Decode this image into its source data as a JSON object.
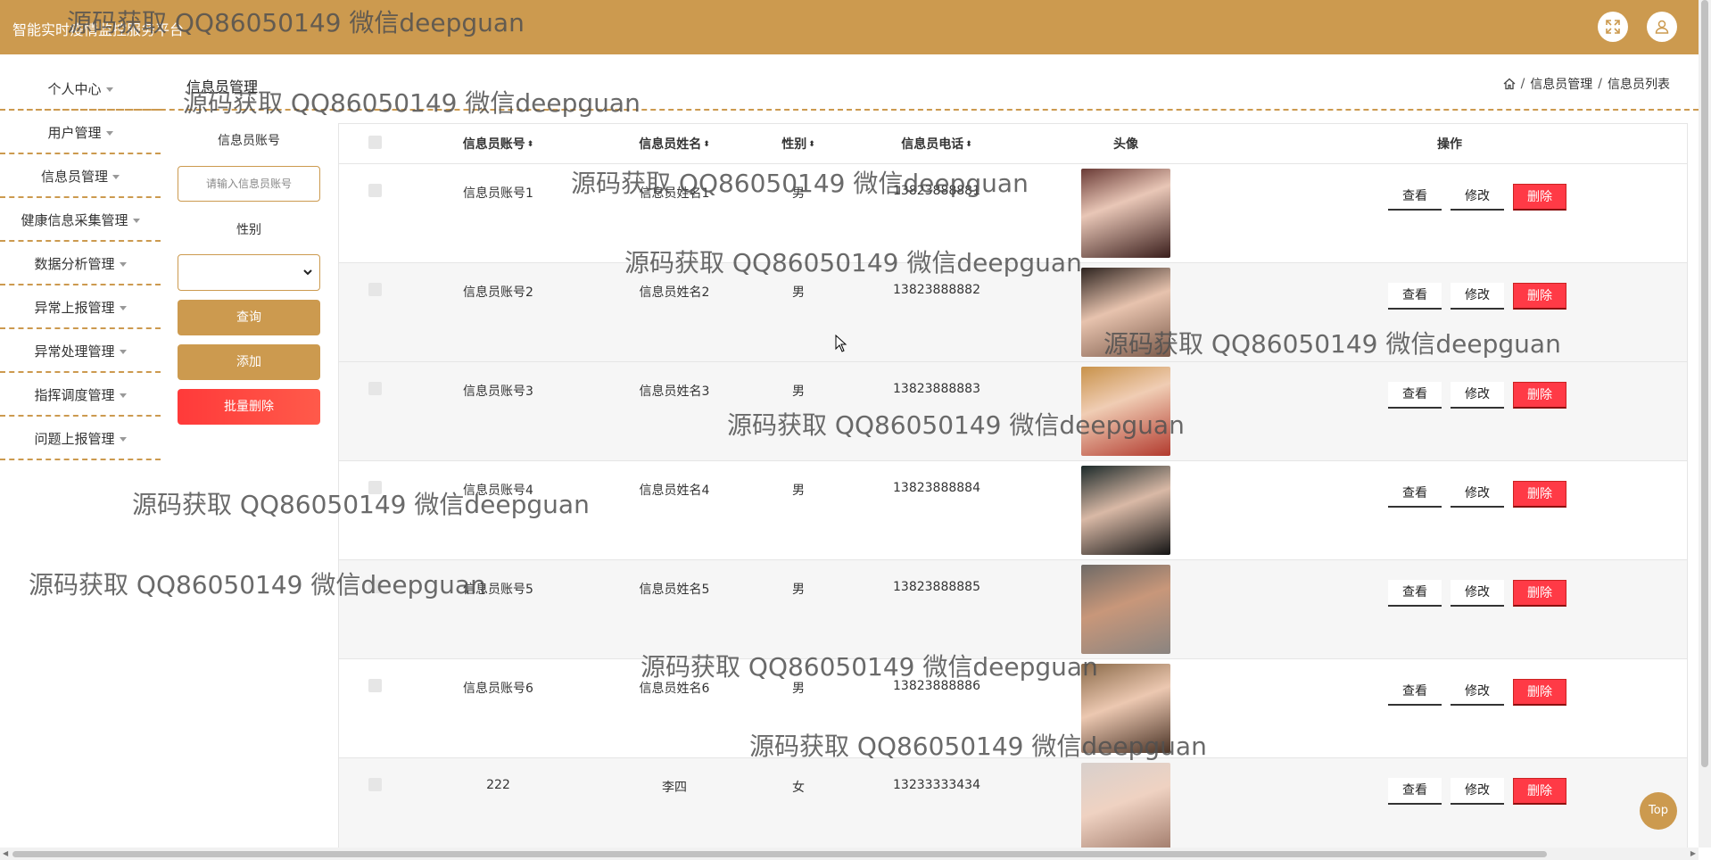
{
  "app": {
    "title": "智能实时疫情监控服务平台"
  },
  "sidebar": {
    "items": [
      {
        "label": "个人中心"
      },
      {
        "label": "用户管理"
      },
      {
        "label": "信息员管理"
      },
      {
        "label": "健康信息采集管理"
      },
      {
        "label": "数据分析管理"
      },
      {
        "label": "异常上报管理"
      },
      {
        "label": "异常处理管理"
      },
      {
        "label": "指挥调度管理"
      },
      {
        "label": "问题上报管理"
      }
    ]
  },
  "page": {
    "section_title": "信息员管理",
    "breadcrumb": [
      "信息员管理",
      "信息员列表"
    ]
  },
  "filter": {
    "account_label": "信息员账号",
    "account_placeholder": "请输入信息员账号",
    "account_value": "",
    "gender_label": "性别",
    "gender_selected": "",
    "query_label": "查询",
    "add_label": "添加",
    "batch_delete_label": "批量删除"
  },
  "table": {
    "headers": {
      "account": "信息员账号",
      "name": "信息员姓名",
      "gender": "性别",
      "phone": "信息员电话",
      "avatar": "头像",
      "actions": "操作"
    },
    "rows": [
      {
        "account": "信息员账号1",
        "name": "信息员姓名1",
        "gender": "男",
        "phone": "13823888881"
      },
      {
        "account": "信息员账号2",
        "name": "信息员姓名2",
        "gender": "男",
        "phone": "13823888882"
      },
      {
        "account": "信息员账号3",
        "name": "信息员姓名3",
        "gender": "男",
        "phone": "13823888883"
      },
      {
        "account": "信息员账号4",
        "name": "信息员姓名4",
        "gender": "男",
        "phone": "13823888884"
      },
      {
        "account": "信息员账号5",
        "name": "信息员姓名5",
        "gender": "男",
        "phone": "13823888885"
      },
      {
        "account": "信息员账号6",
        "name": "信息员姓名6",
        "gender": "男",
        "phone": "13823888886"
      },
      {
        "account": "222",
        "name": "李四",
        "gender": "女",
        "phone": "13233333434"
      }
    ],
    "actions": {
      "view": "查看",
      "edit": "修改",
      "delete": "删除"
    }
  },
  "back_to_top": "Top",
  "watermark": "源码获取 QQ86050149 微信deepguan",
  "colors": {
    "brand": "#cc9a4f",
    "danger": "#ff3a46"
  },
  "icons": {
    "fullscreen": "fullscreen-icon",
    "user": "user-icon",
    "home": "home-icon"
  }
}
